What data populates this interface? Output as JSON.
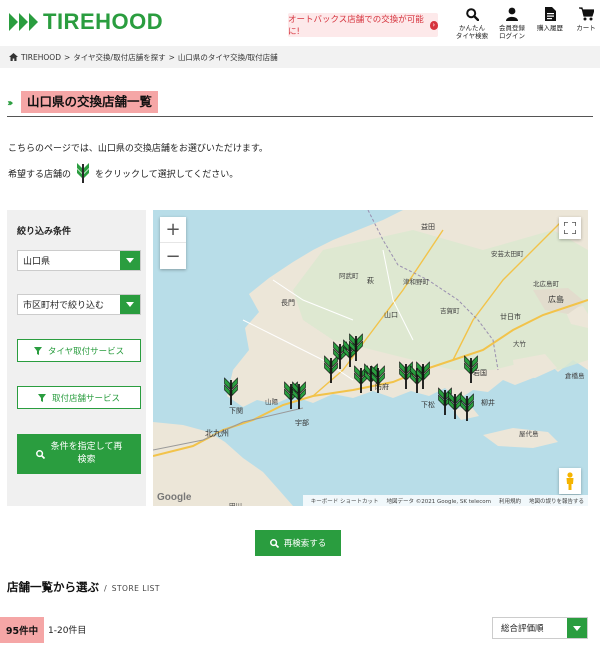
{
  "header": {
    "logo_text": "TIREHOOD",
    "promo_text": "オートバックス店舗での交換が可能に!",
    "nav": [
      {
        "label": "かんたん\nタイヤ検索",
        "icon": "search-icon"
      },
      {
        "label": "会員登録\nログイン",
        "icon": "user-icon"
      },
      {
        "label": "購入履歴",
        "icon": "document-icon"
      },
      {
        "label": "カート",
        "icon": "cart-icon"
      }
    ]
  },
  "breadcrumb": {
    "items": [
      "TIREHOOD",
      "タイヤ交換/取付店舗を探す",
      "山口県のタイヤ交換/取付店舗"
    ],
    "separator": ">"
  },
  "page": {
    "title": "山口県の交換店舗一覧",
    "intro_line1": "こちらのページでは、山口県の交換店舗をお選びいただけます。",
    "intro_line2_before": "希望する店舗の",
    "intro_line2_after": "をクリックして選択してください。"
  },
  "filter": {
    "title": "絞り込み条件",
    "prefecture_value": "山口県",
    "city_value": "市区町村で絞り込む",
    "service_button_1": "タイヤ取付サービス",
    "service_button_2": "取付店舗サービス",
    "search_button": "条件を指定して再\n検索"
  },
  "map": {
    "zoom_in": "+",
    "zoom_out": "−",
    "google_mark": "Google",
    "attribution": [
      "キーボード ショートカット",
      "地図データ ©2021 Google, SK telecom",
      "利用規約",
      "地図の誤りを報告する"
    ],
    "labels": [
      {
        "text": "益田",
        "kind": "city"
      },
      {
        "text": "安芸太田町",
        "kind": "town"
      },
      {
        "text": "阿武町",
        "kind": "town"
      },
      {
        "text": "萩",
        "kind": "city"
      },
      {
        "text": "津和野町",
        "kind": "town"
      },
      {
        "text": "北広島町",
        "kind": "town"
      },
      {
        "text": "長門",
        "kind": "city"
      },
      {
        "text": "山口",
        "kind": "city"
      },
      {
        "text": "吉賀町",
        "kind": "town"
      },
      {
        "text": "廿日市",
        "kind": "city"
      },
      {
        "text": "広島",
        "kind": "city"
      },
      {
        "text": "大竹",
        "kind": "city"
      },
      {
        "text": "岩国",
        "kind": "city"
      },
      {
        "text": "下関",
        "kind": "city"
      },
      {
        "text": "山陽",
        "kind": "town"
      },
      {
        "text": "宇部",
        "kind": "city"
      },
      {
        "text": "防府",
        "kind": "city"
      },
      {
        "text": "下松",
        "kind": "city"
      },
      {
        "text": "柳井",
        "kind": "city"
      },
      {
        "text": "倉橋島",
        "kind": "town"
      },
      {
        "text": "北九州",
        "kind": "city"
      },
      {
        "text": "屋代島",
        "kind": "town"
      },
      {
        "text": "田川",
        "kind": "town"
      }
    ]
  },
  "research_button": "再検索する",
  "list": {
    "title": "店舗一覧から選ぶ",
    "subtitle": "STORE LIST",
    "count": "95件中",
    "range": "1-20件目",
    "sort_value": "総合評価順"
  },
  "colors": {
    "brand_green": "#2a9d3f",
    "highlight_pink": "#f5a6a6",
    "promo_red": "#d6343e"
  }
}
